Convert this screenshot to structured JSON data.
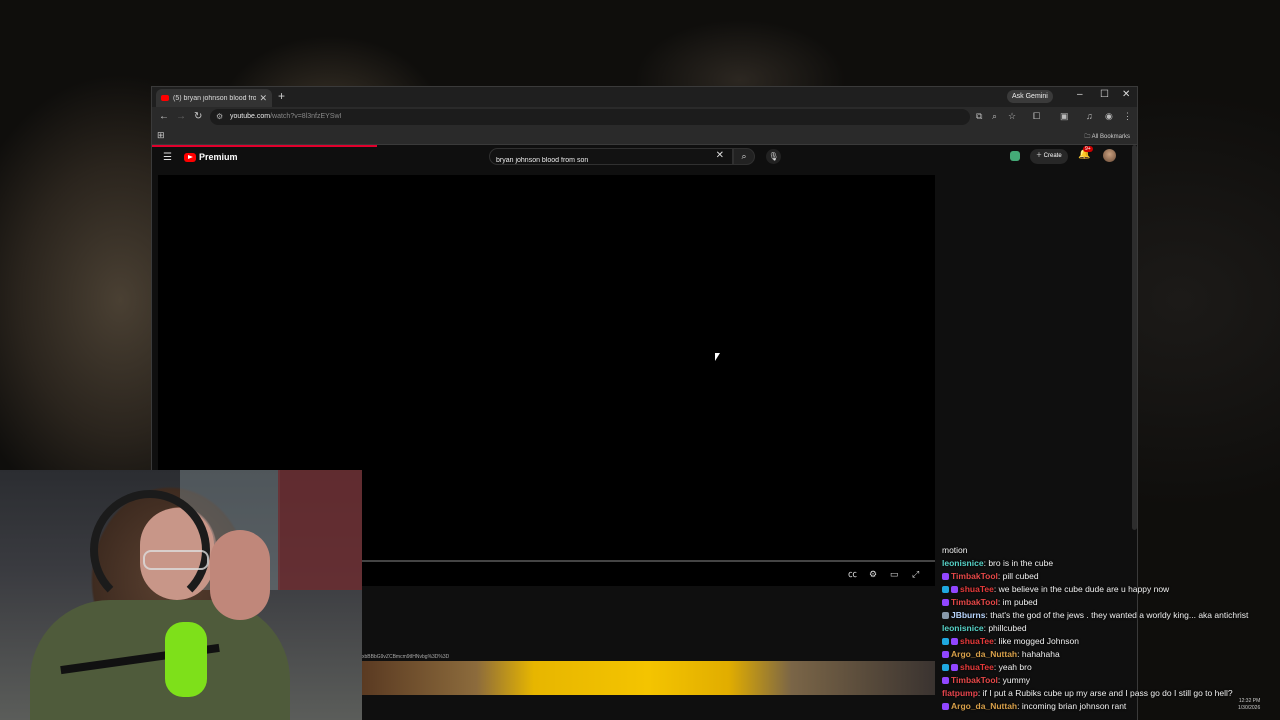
{
  "browser": {
    "tab_title": "(5) bryan johnson blood from",
    "new_tab": "+",
    "gemini": "Ask Gemini",
    "url_host": "youtube.com",
    "url_path": "/watch?v=8l3nfzEYSwI",
    "bookmarks_label": "All Bookmarks"
  },
  "youtube": {
    "logo": "Premium",
    "search_value": "bryan johnson blood from son",
    "create_label": "Create",
    "notif_count": "9+",
    "desc_text": "xbBBbG9vZCBmcm9tIHNvbg%3D%3D"
  },
  "chat": [
    {
      "user": "",
      "color": "#ffffff",
      "text": "motion",
      "badges": []
    },
    {
      "user": "leonisnice",
      "color": "#57d3c8",
      "text": "bro is in the cube",
      "badges": []
    },
    {
      "user": "TimbakTool",
      "color": "#e64848",
      "text": "pill cubed",
      "badges": [
        "#9146ff"
      ]
    },
    {
      "user": "shuaTee",
      "color": "#e63a3a",
      "text": "we believe in the cube dude are u happy now",
      "badges": [
        "#1fa8e0",
        "#9146ff"
      ]
    },
    {
      "user": "TimbakTool",
      "color": "#e64848",
      "text": "im pubed",
      "badges": [
        "#9146ff"
      ]
    },
    {
      "user": "JBburns",
      "color": "#b9d6ff",
      "text": "that's the god of the jews . they wanted a worldy king... aka antichrist",
      "badges": [
        "#8899aa"
      ]
    },
    {
      "user": "leonisnice",
      "color": "#57d3c8",
      "text": "phillcubed",
      "badges": []
    },
    {
      "user": "shuaTee",
      "color": "#e63a3a",
      "text": "like mogged Johnson",
      "badges": [
        "#1fa8e0",
        "#9146ff"
      ]
    },
    {
      "user": "Argo_da_Nuttah",
      "color": "#d8a04a",
      "text": "hahahaha",
      "badges": [
        "#9146ff"
      ]
    },
    {
      "user": "shuaTee",
      "color": "#e63a3a",
      "text": "yeah bro",
      "badges": [
        "#1fa8e0",
        "#9146ff"
      ]
    },
    {
      "user": "TimbakTool",
      "color": "#e64848",
      "text": "yummy",
      "badges": [
        "#9146ff"
      ]
    },
    {
      "user": "flatpump",
      "color": "#e6454d",
      "text": "if I put a Rubiks cube up my arse and I pass go do I still go to hell?",
      "badges": []
    },
    {
      "user": "Argo_da_Nuttah",
      "color": "#d8a04a",
      "text": "incoming brian johnson rant",
      "badges": [
        "#9146ff"
      ]
    }
  ],
  "taskbar": {
    "time": "12:32 PM",
    "date": "1/30/2026"
  }
}
